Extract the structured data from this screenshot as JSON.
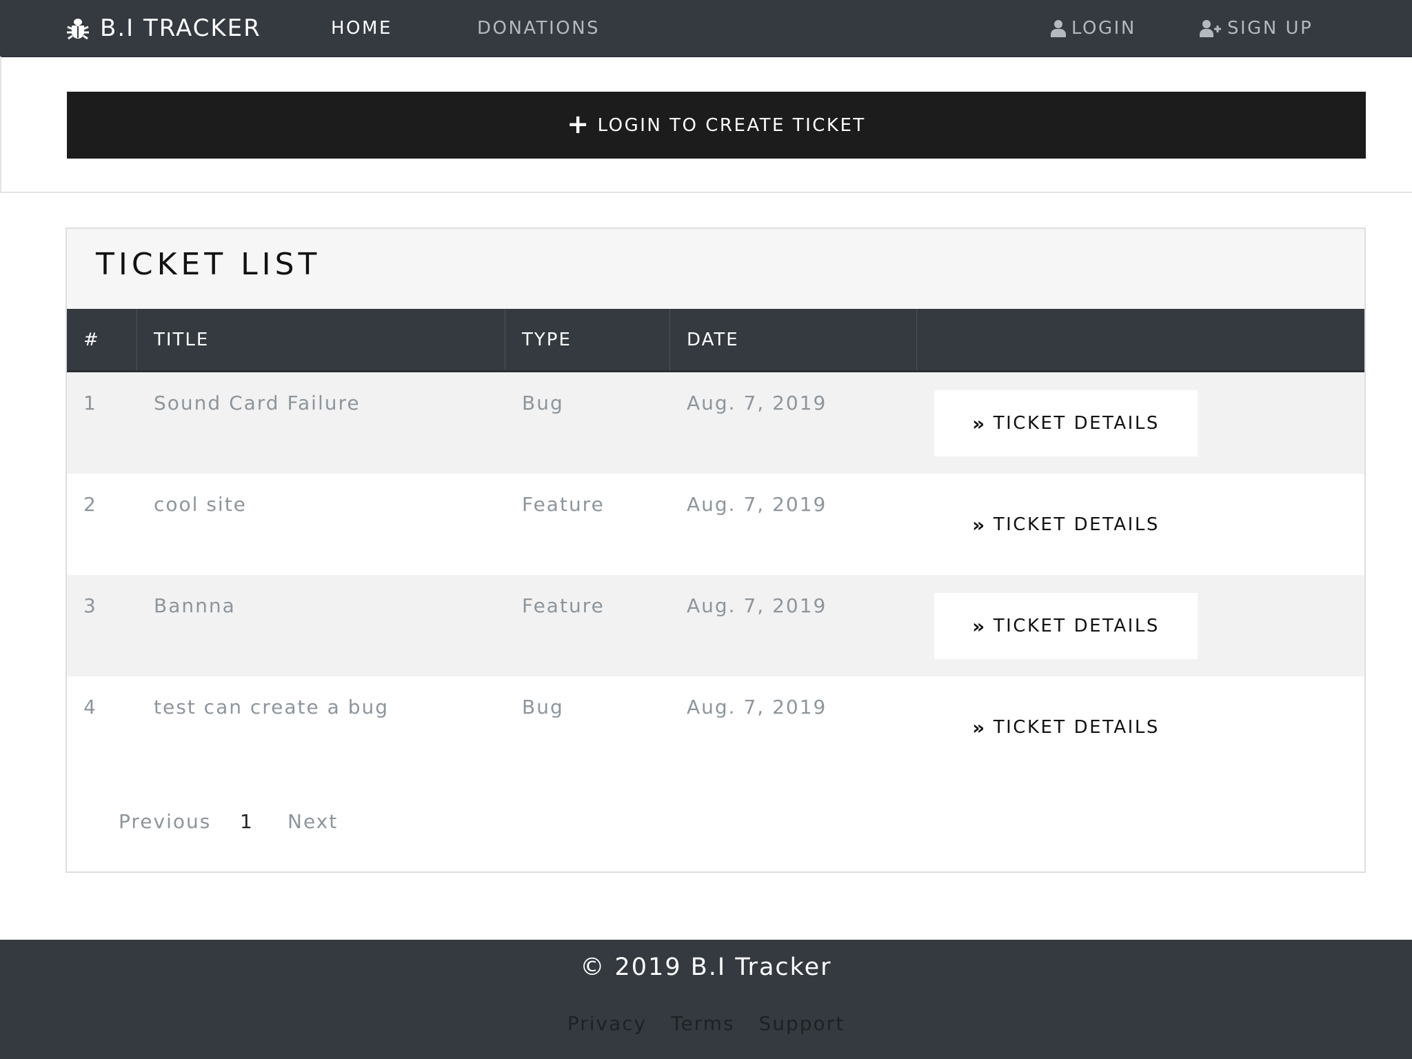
{
  "navbar": {
    "brand": "B.I TRACKER",
    "brand_icon": "bug-icon",
    "links": [
      "HOME",
      "DONATIONS"
    ],
    "login": "LOGIN",
    "signup": "SIGN UP"
  },
  "create": {
    "label": "LOGIN TO CREATE TICKET"
  },
  "ticket_list": {
    "title": "TICKET LIST",
    "columns": [
      "#",
      "TITLE",
      "TYPE",
      "DATE",
      ""
    ],
    "details_label": "TICKET DETAILS",
    "rows": [
      {
        "num": "1",
        "title": "Sound Card Failure",
        "type": "Bug",
        "date": "Aug. 7, 2019"
      },
      {
        "num": "2",
        "title": "cool site",
        "type": "Feature",
        "date": "Aug. 7, 2019"
      },
      {
        "num": "3",
        "title": "Bannna",
        "type": "Feature",
        "date": "Aug. 7, 2019"
      },
      {
        "num": "4",
        "title": "test can create a bug",
        "type": "Bug",
        "date": "Aug. 7, 2019"
      }
    ]
  },
  "pagination": {
    "previous": "Previous",
    "current": "1",
    "next": "Next"
  },
  "footer": {
    "copyright": "© 2019 B.I Tracker",
    "links": [
      "Privacy",
      "Terms",
      "Support"
    ]
  },
  "colors": {
    "navbar": "#343a40",
    "create_bar": "#1c1c1c",
    "muted_text": "#8d959c"
  }
}
